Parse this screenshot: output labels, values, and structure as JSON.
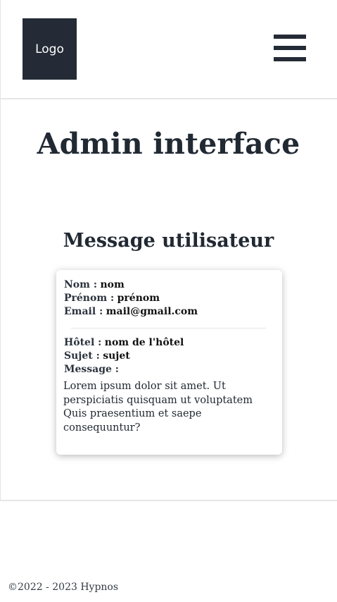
{
  "header": {
    "logo": "Logo",
    "menu_icon": "hamburger-menu-icon"
  },
  "main": {
    "title": "Admin interface",
    "section_title": "Message utilisateur"
  },
  "message": {
    "nom_label": "Nom :",
    "nom_value": "nom",
    "prenom_label": "Prénom :",
    "prenom_value": "prénom",
    "email_label": "Email :",
    "email_value": "mail@gmail.com",
    "hotel_label": "Hôtel :",
    "hotel_value": "nom de l'hôtel",
    "sujet_label": "Sujet :",
    "sujet_value": "sujet",
    "message_label": "Message :",
    "message_body": "Lorem ipsum dolor sit amet. Ut perspiciatis quisquam ut voluptatem Quis praesentium et saepe consequuntur?"
  },
  "footer": {
    "copyright": "©2022 - 2023 Hypnos"
  },
  "colors": {
    "dark": "#242b36",
    "divider": "#e6e6e6",
    "background": "#ffffff"
  }
}
